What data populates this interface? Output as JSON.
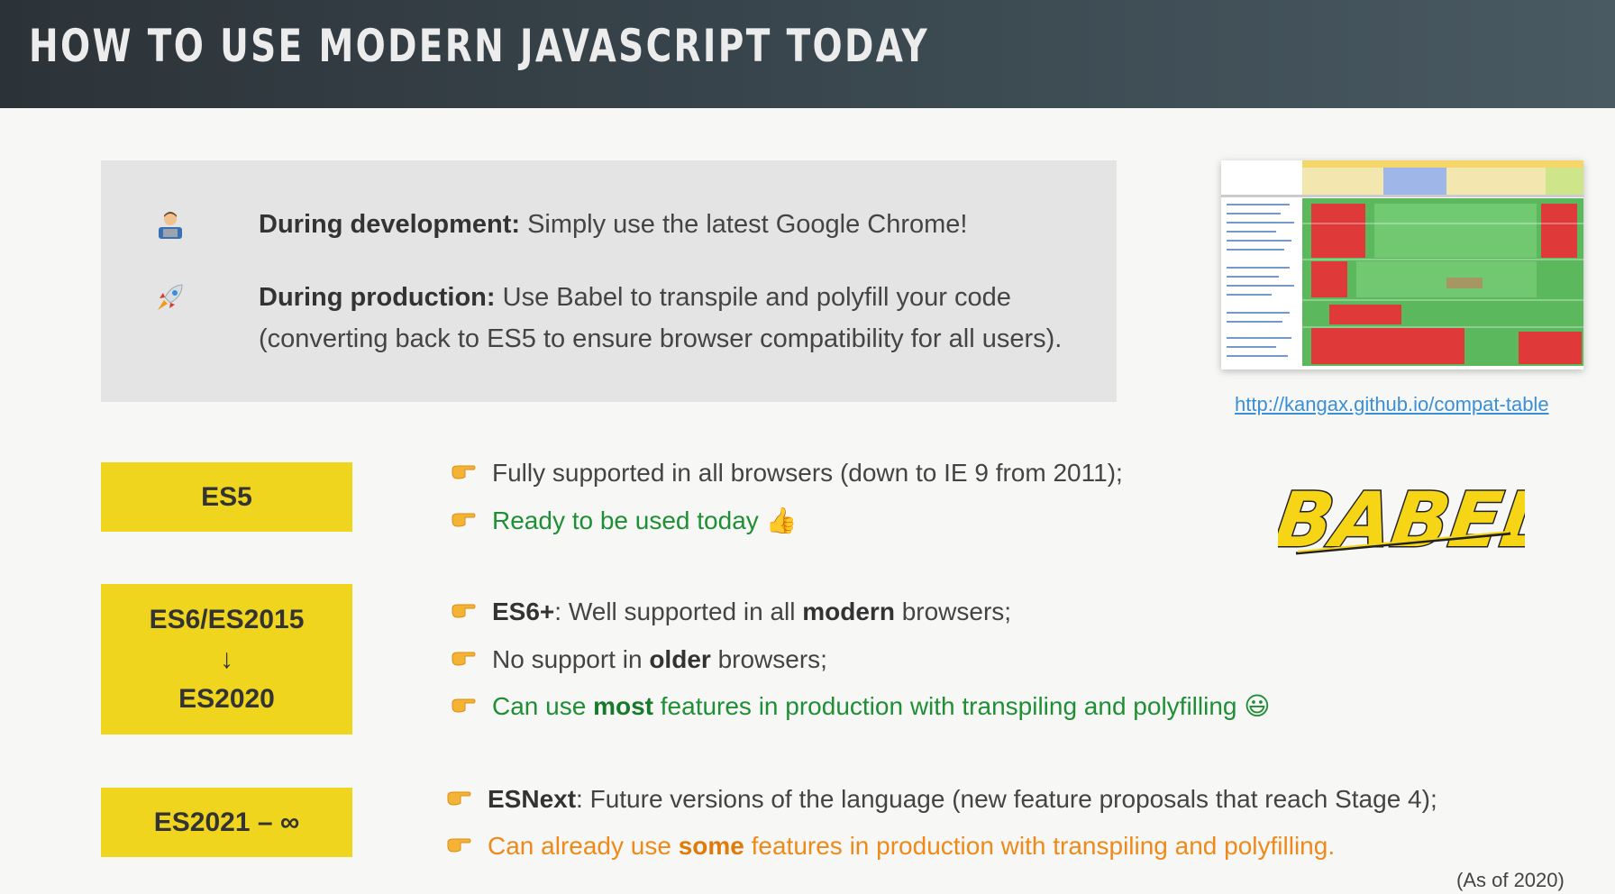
{
  "header": {
    "title": "HOW TO USE MODERN JAVASCRIPT TODAY"
  },
  "dev_box": {
    "development": {
      "icon": "technologist-icon",
      "label": "During development:",
      "text": " Simply use the latest Google Chrome!"
    },
    "production": {
      "icon": "rocket-icon",
      "label": "During production:",
      "text": " Use Babel to transpile and polyfill your code (converting back to ES5 to ensure browser compatibility for all users)."
    }
  },
  "compat": {
    "link": "http://kangax.github.io/compat-table"
  },
  "es5": {
    "badge": "ES5",
    "bullet1": "Fully supported in all browsers (down to IE 9 from 2011);",
    "bullet2": "Ready to be used today 👍"
  },
  "es6": {
    "badge_top": "ES6/ES2015",
    "badge_arrow": "↓",
    "badge_bottom": "ES2020",
    "b1_bold": "ES6+",
    "b1_mid": ": Well supported in all ",
    "b1_bold2": "modern",
    "b1_end": " browsers;",
    "b2_start": "No support in ",
    "b2_bold": "older",
    "b2_end": " browsers;",
    "b3_start": "Can use ",
    "b3_bold": "most",
    "b3_end": " features in production with transpiling and polyfilling 😃"
  },
  "esnext": {
    "badge": "ES2021 – ∞",
    "b1_bold": "ESNext",
    "b1_end": ": Future versions of the language (new feature proposals that reach Stage 4);",
    "b2_start": "Can already use ",
    "b2_bold": "some",
    "b2_end": " features in production with transpiling and polyfilling."
  },
  "babel_logo": "BABEL",
  "footnote": "(As of 2020)",
  "colors": {
    "badge": "#f0d51e",
    "green": "#1f8f35",
    "orange": "#ee8a19",
    "link": "#3b8fd6"
  }
}
